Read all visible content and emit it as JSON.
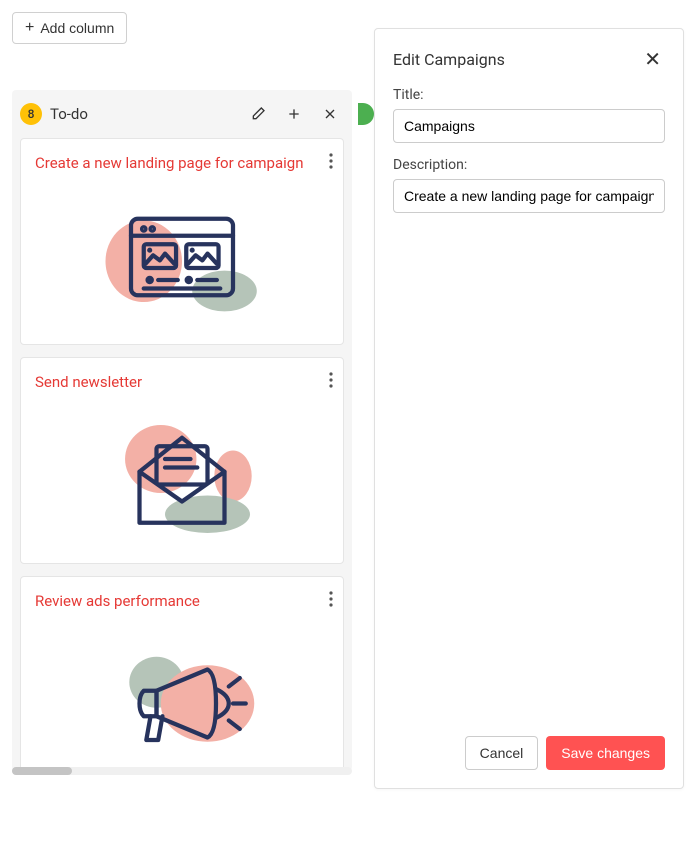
{
  "toolbar": {
    "add_column_label": "Add column"
  },
  "column": {
    "badge_count": "8",
    "title": "To-do",
    "cards": [
      {
        "title": "Create a new landing page for campaign"
      },
      {
        "title": "Send newsletter"
      },
      {
        "title": "Review ads performance"
      }
    ]
  },
  "panel": {
    "title": "Edit Campaigns",
    "title_label": "Title:",
    "title_value": "Campaigns",
    "description_label": "Description:",
    "description_value": "Create a new landing page for campaign",
    "cancel_label": "Cancel",
    "save_label": "Save changes"
  }
}
